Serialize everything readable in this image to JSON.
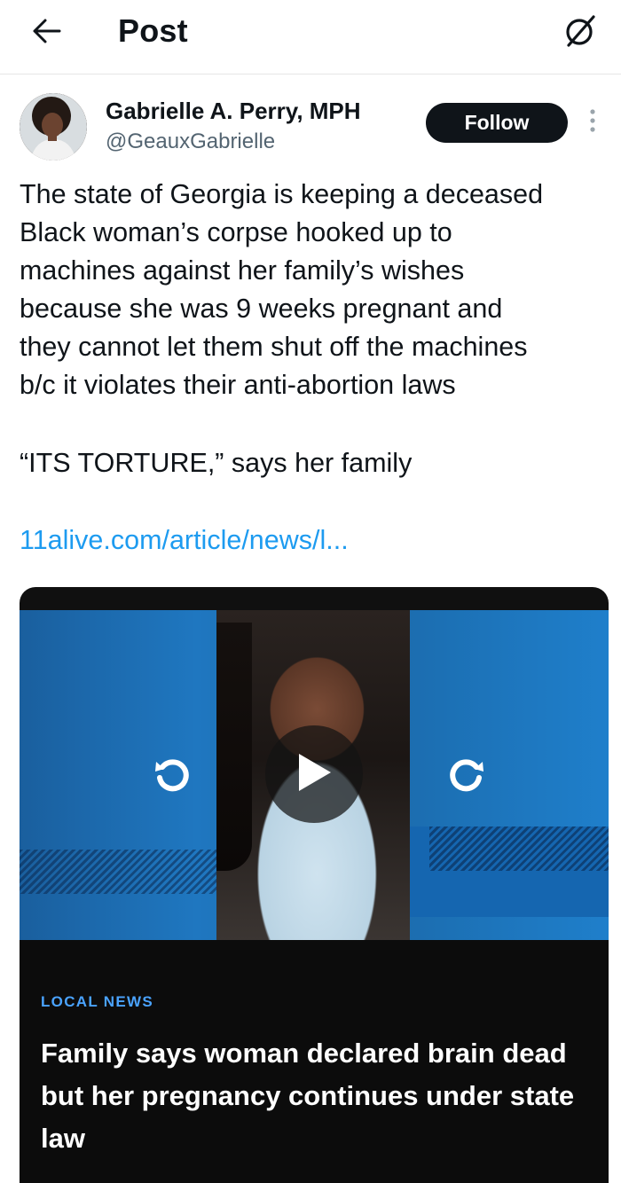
{
  "header": {
    "title": "Post",
    "back_icon": "arrow-left-icon",
    "right_icon": "grok-icon"
  },
  "author": {
    "name": "Gabrielle A. Perry, MPH",
    "handle": "@GeauxGabrielle",
    "follow_label": "Follow",
    "more_icon": "more-vertical-icon"
  },
  "post": {
    "text": "The state of Georgia is keeping a deceased\nBlack woman’s corpse hooked up to\nmachines against her family’s wishes\nbecause she was 9 weeks pregnant and\nthey cannot let them shut off the machines\nb/c it violates their anti-abortion laws",
    "quote": "“ITS TORTURE,” says her family",
    "link": "11alive.com/article/news/l..."
  },
  "media_card": {
    "category": "LOCAL NEWS",
    "headline": "Family says woman declared brain dead but her pregnancy continues under state law",
    "controls": [
      "replay-icon",
      "play-icon",
      "forward-icon"
    ],
    "colors": {
      "background": "#1f77c0",
      "category": "#4aa3ff",
      "caption_bg": "#0c0c0c"
    }
  },
  "colors": {
    "link": "#1d9bf0",
    "follow_button": "#0f1419",
    "handle": "#536471"
  }
}
